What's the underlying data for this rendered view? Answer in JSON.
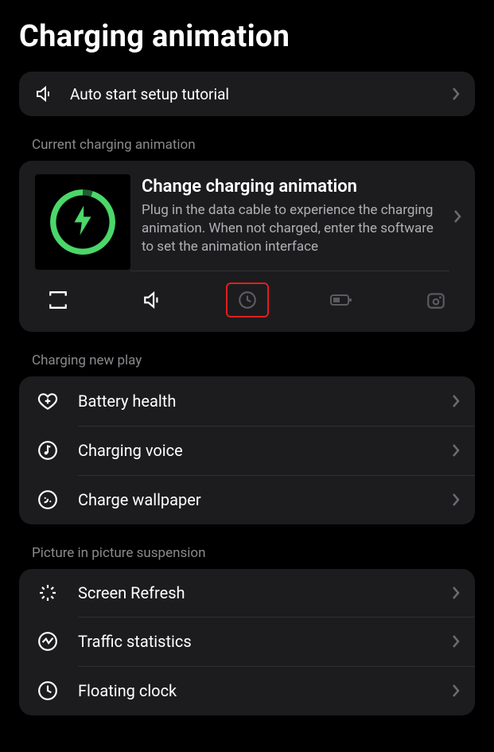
{
  "header": {
    "title": "Charging animation"
  },
  "tutorial": {
    "label": "Auto start setup tutorial"
  },
  "current": {
    "section_label": "Current charging animation",
    "title": "Change charging animation",
    "desc": "Plug in the data cable to experience the charging animation. When not charged, enter the software to set the animation interface",
    "tools": [
      "loop",
      "sound",
      "clock",
      "battery",
      "camera"
    ]
  },
  "newplay": {
    "section_label": "Charging new play",
    "items": [
      {
        "label": "Battery health"
      },
      {
        "label": "Charging voice"
      },
      {
        "label": "Charge wallpaper"
      }
    ]
  },
  "pip": {
    "section_label": "Picture in picture suspension",
    "items": [
      {
        "label": "Screen Refresh"
      },
      {
        "label": "Traffic statistics"
      },
      {
        "label": "Floating clock"
      }
    ]
  }
}
